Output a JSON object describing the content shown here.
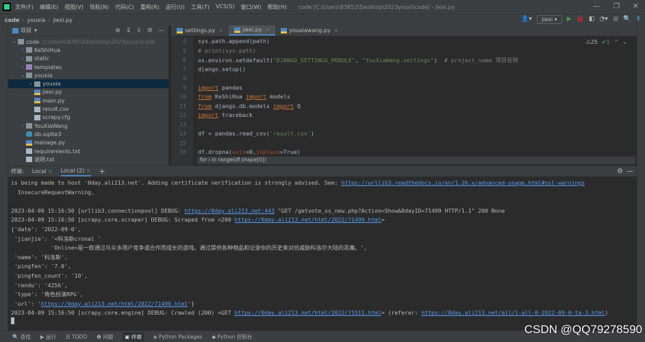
{
  "titlebar": {
    "menus": [
      "文件(F)",
      "编辑(E)",
      "视图(V)",
      "导航(N)",
      "代码(C)",
      "重构(R)",
      "运行(U)",
      "工具(T)",
      "VCS(S)",
      "窗口(W)",
      "帮助(H)"
    ],
    "window_title": "code [C:\\Users\\83852\\Desktop\\2023youxi\\code] - jiexi.py"
  },
  "breadcrumb": [
    "code",
    "youxia",
    "jiexi.py"
  ],
  "toolbar": {
    "run_config": "jiexi"
  },
  "project": {
    "title": "项目",
    "tree": [
      {
        "label": "code",
        "path": "C:\\Users\\83852\\Desktop\\2023youxi\\code",
        "depth": 0,
        "arrow": "v",
        "icon": "folder"
      },
      {
        "label": "KeShiHua",
        "depth": 1,
        "arrow": ">",
        "icon": "folder"
      },
      {
        "label": "static",
        "depth": 1,
        "arrow": ">",
        "icon": "folder"
      },
      {
        "label": "templates",
        "depth": 1,
        "arrow": ">",
        "icon": "folder purple"
      },
      {
        "label": "youxia",
        "depth": 1,
        "arrow": "v",
        "icon": "folder"
      },
      {
        "label": "youxia",
        "depth": 2,
        "arrow": ">",
        "icon": "folder",
        "selected": true
      },
      {
        "label": "jiexi.py",
        "depth": 2,
        "arrow": "",
        "icon": "pyf"
      },
      {
        "label": "main.py",
        "depth": 2,
        "arrow": "",
        "icon": "pyf"
      },
      {
        "label": "result.csv",
        "depth": 2,
        "arrow": "",
        "icon": "txtf"
      },
      {
        "label": "scrapy.cfg",
        "depth": 2,
        "arrow": "",
        "icon": "txtf"
      },
      {
        "label": "YouXiaWang",
        "depth": 1,
        "arrow": ">",
        "icon": "folder"
      },
      {
        "label": "db.sqlite3",
        "depth": 1,
        "arrow": "",
        "icon": "dbf"
      },
      {
        "label": "manage.py",
        "depth": 1,
        "arrow": "",
        "icon": "pyf"
      },
      {
        "label": "requirements.txt",
        "depth": 1,
        "arrow": "",
        "icon": "txtf"
      },
      {
        "label": "说明.txt",
        "depth": 1,
        "arrow": "",
        "icon": "txtf"
      }
    ]
  },
  "editor": {
    "tabs": [
      {
        "label": "settings.py"
      },
      {
        "label": "jiexi.py",
        "active": true
      },
      {
        "label": "youxiawang.py"
      }
    ],
    "warnings": "25",
    "ok": "1",
    "lines": [
      {
        "n": "4",
        "segs": [
          [
            "",
            "sys.path.append(path)"
          ]
        ]
      },
      {
        "n": "5",
        "segs": [
          [
            "cm",
            "# print(sys.path)"
          ]
        ]
      },
      {
        "n": "6",
        "segs": [
          [
            "",
            "os.environ.setdefault("
          ],
          [
            "str",
            "\"DJANGO_SETTINGS_MODULE\""
          ],
          [
            "",
            ", "
          ],
          [
            "str",
            "\"YouXiaWang.settings\""
          ],
          [
            "",
            ")  "
          ],
          [
            "cm",
            "# project_name 项目名称"
          ]
        ]
      },
      {
        "n": "7",
        "segs": [
          [
            "",
            "django.setup()"
          ]
        ]
      },
      {
        "n": "8",
        "segs": []
      },
      {
        "n": "9",
        "segs": [
          [
            "kw",
            "import"
          ],
          [
            "",
            " pandas"
          ]
        ]
      },
      {
        "n": "10",
        "segs": [
          [
            "kw",
            "from"
          ],
          [
            "",
            " KeShiHua "
          ],
          [
            "kw",
            "import"
          ],
          [
            "",
            " models"
          ]
        ]
      },
      {
        "n": "11",
        "segs": [
          [
            "kw",
            "from"
          ],
          [
            "",
            " django.db.models "
          ],
          [
            "kw",
            "import"
          ],
          [
            "",
            " Q"
          ]
        ]
      },
      {
        "n": "12",
        "segs": [
          [
            "kw",
            "import"
          ],
          [
            "",
            " traceback"
          ]
        ]
      },
      {
        "n": "13",
        "segs": []
      },
      {
        "n": "14",
        "segs": [
          [
            "",
            "df = pandas.read_csv("
          ],
          [
            "str",
            "'result.csv'"
          ],
          [
            "",
            ")"
          ]
        ]
      },
      {
        "n": "15",
        "segs": []
      },
      {
        "n": "16",
        "segs": [
          [
            "",
            "df.dropna("
          ],
          [
            "named",
            "axis"
          ],
          [
            "",
            "=0,"
          ],
          [
            "named",
            "inplace"
          ],
          [
            "",
            "=True)"
          ]
        ]
      }
    ],
    "hint": "for i in range(df.shape[0])"
  },
  "terminal": {
    "label": "终端:",
    "tabs": [
      {
        "label": "Local"
      },
      {
        "label": "Local (2)",
        "active": true
      }
    ],
    "lines": [
      [
        [
          "",
          "is being made to host '0day.ali213.net'. Adding certificate verification is strongly advised. See: "
        ],
        [
          "link",
          "https://urllib3.readthedocs.io/en/1.26.x/advanced-usage.html#ssl-warnings"
        ]
      ],
      [
        [
          "",
          "  InsecureRequestWarning,"
        ]
      ],
      [],
      [
        [
          "",
          "2023-04-09 15:16:50 [urllib3.connectionpool] DEBUG: "
        ],
        [
          "link",
          "https://0day.ali213.net:443"
        ],
        [
          "",
          " \"GET /getvote_xs_new.php?Action=Show&0dayID=71499 HTTP/1.1\" 200 None"
        ]
      ],
      [
        [
          "",
          "2023-04-09 15:16:50 [scrapy.core.scraper] DEBUG: Scraped from <200 "
        ],
        [
          "link",
          "https://0day.ali213.net/html/2022/71499.html"
        ],
        [
          "",
          ">"
        ]
      ],
      [
        [
          "",
          "{'date': '2022-09-0',"
        ]
      ],
      [
        [
          "",
          "",
          " 'jianjie': '<科洛斯cronal '"
        ]
      ],
      [
        [
          "",
          "            'Online>是一款通过与众多用户竞争或合作而成长的游戏。通过提供各种物品和记录你的历史来对抗威胁科洛尔大陆的恶魔。',"
        ]
      ],
      [
        [
          "",
          "",
          " 'name': '科洛斯',"
        ]
      ],
      [
        [
          "",
          "",
          " 'pingfen': '7.0',"
        ]
      ],
      [
        [
          "",
          "",
          " 'pingfen_count': '10',"
        ]
      ],
      [
        [
          "",
          "",
          " 'rendu': '4256',"
        ]
      ],
      [
        [
          "",
          "",
          " 'type': '角色扮演RPG',"
        ]
      ],
      [
        [
          "",
          "",
          " 'url': '"
        ],
        [
          "link",
          "https://0day.ali213.net/html/2022/71499.html"
        ],
        [
          "",
          "'}"
        ]
      ],
      [
        [
          "",
          "2023-04-09 15:16:50 [scrapy.core.engine] DEBUG: Crawled (200) <GET "
        ],
        [
          "link",
          "https://0day.ali213.net/html/2022/71511.html"
        ],
        [
          "",
          "> (referer: "
        ],
        [
          "link",
          "https://0day.ali213.net/all/1-all-0-2022-09-0-ta-3.html"
        ],
        [
          "",
          ")"
        ]
      ]
    ]
  },
  "bottombar": [
    "查找",
    "运行",
    "TODO",
    "问题",
    "终端",
    "Python Packages",
    "Python 控制台"
  ],
  "bottombar_active": "终端",
  "watermark": "CSDN @QQ79278590"
}
